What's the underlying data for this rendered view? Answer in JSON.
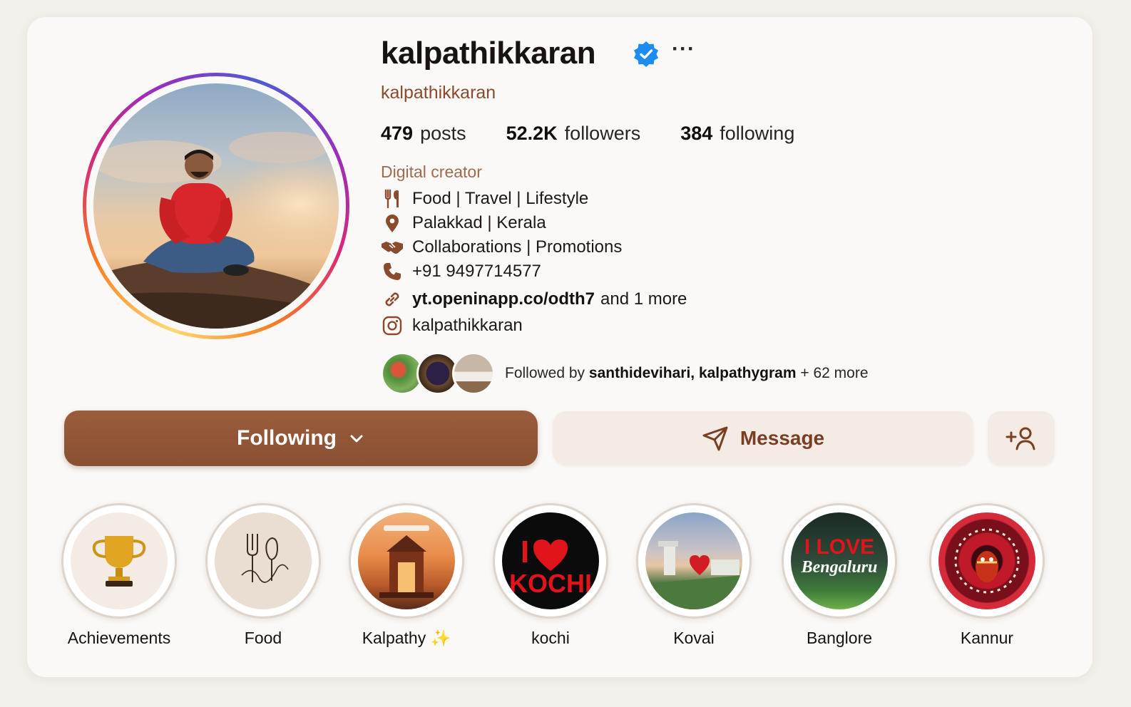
{
  "profile": {
    "username": "kalpathikkaran",
    "handle": "kalpathikkaran",
    "more_label": "···",
    "category": "Digital creator"
  },
  "stats": {
    "posts_count": "479",
    "posts_label": "posts",
    "followers_count": "52.2K",
    "followers_label": "followers",
    "following_count": "384",
    "following_label": "following"
  },
  "bio": {
    "line1": "Food | Travel | Lifestyle",
    "line2": "Palakkad | Kerala",
    "line3": "Collaborations | Promotions",
    "phone": "+91 9497714577",
    "link": "yt.openinapp.co/odth7",
    "link_more": "and 1 more",
    "instagram": "kalpathikkaran"
  },
  "followed_by": {
    "prefix": "Followed by",
    "names": "santhidevihari, kalpathygram",
    "suffix": "+ 62 more"
  },
  "actions": {
    "following_label": "Following",
    "message_label": "Message"
  },
  "highlights": [
    {
      "label": "Achievements"
    },
    {
      "label": "Food"
    },
    {
      "label": "Kalpathy ✨"
    },
    {
      "label": "kochi"
    },
    {
      "label": "Kovai"
    },
    {
      "label": "Banglore"
    },
    {
      "label": "Kannur"
    }
  ],
  "highlight_art": {
    "kochi_line1": "I",
    "kochi_line2": "KOCHI",
    "bangalore_line1": "I LOVE",
    "bangalore_line2": "Bengaluru"
  },
  "colors": {
    "accent": "#8b4a2b",
    "verified": "#1d8cf0",
    "following_button": "#8e5334",
    "message_button_bg": "#f4ebe4"
  },
  "icons": {
    "verified": "verified-badge-icon",
    "food": "fork-knife-icon",
    "location": "location-pin-icon",
    "collab": "handshake-icon",
    "phone": "phone-icon",
    "link": "link-icon",
    "instagram": "instagram-icon",
    "message": "send-icon",
    "add_user": "add-user-icon",
    "dropdown": "chevron-down-icon"
  }
}
